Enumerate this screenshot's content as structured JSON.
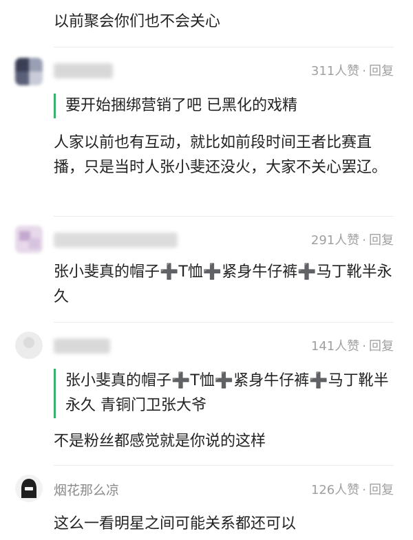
{
  "fragment_top": "以前聚会你们也不会关心",
  "comments": [
    {
      "likes": "311人赞",
      "reply": "回复",
      "quote": "要开始捆绑营销了吧 已黑化的戏精",
      "body": "人家以前也有互动，就比如前段时间王者比赛直播，只是当时人张小斐还没火，大家不关心罢辽。"
    },
    {
      "likes": "291人赞",
      "reply": "回复",
      "body": "张小斐真的帽子➕T恤➕紧身牛仔裤➕马丁靴半永久"
    },
    {
      "likes": "141人赞",
      "reply": "回复",
      "quote": "张小斐真的帽子➕T恤➕紧身牛仔裤➕马丁靴半永久 青铜门卫张大爷",
      "body": "不是粉丝都感觉就是你说的这样"
    },
    {
      "username": "烟花那么凉",
      "likes": "126人赞",
      "reply": "回复",
      "body": "这么一看明星之间可能关系都还可以"
    }
  ],
  "meta_separator": "·",
  "colors": {
    "quote_bar": "#3db06a",
    "meta_text": "#a0a0a0",
    "username_text": "#8a8a8a"
  }
}
